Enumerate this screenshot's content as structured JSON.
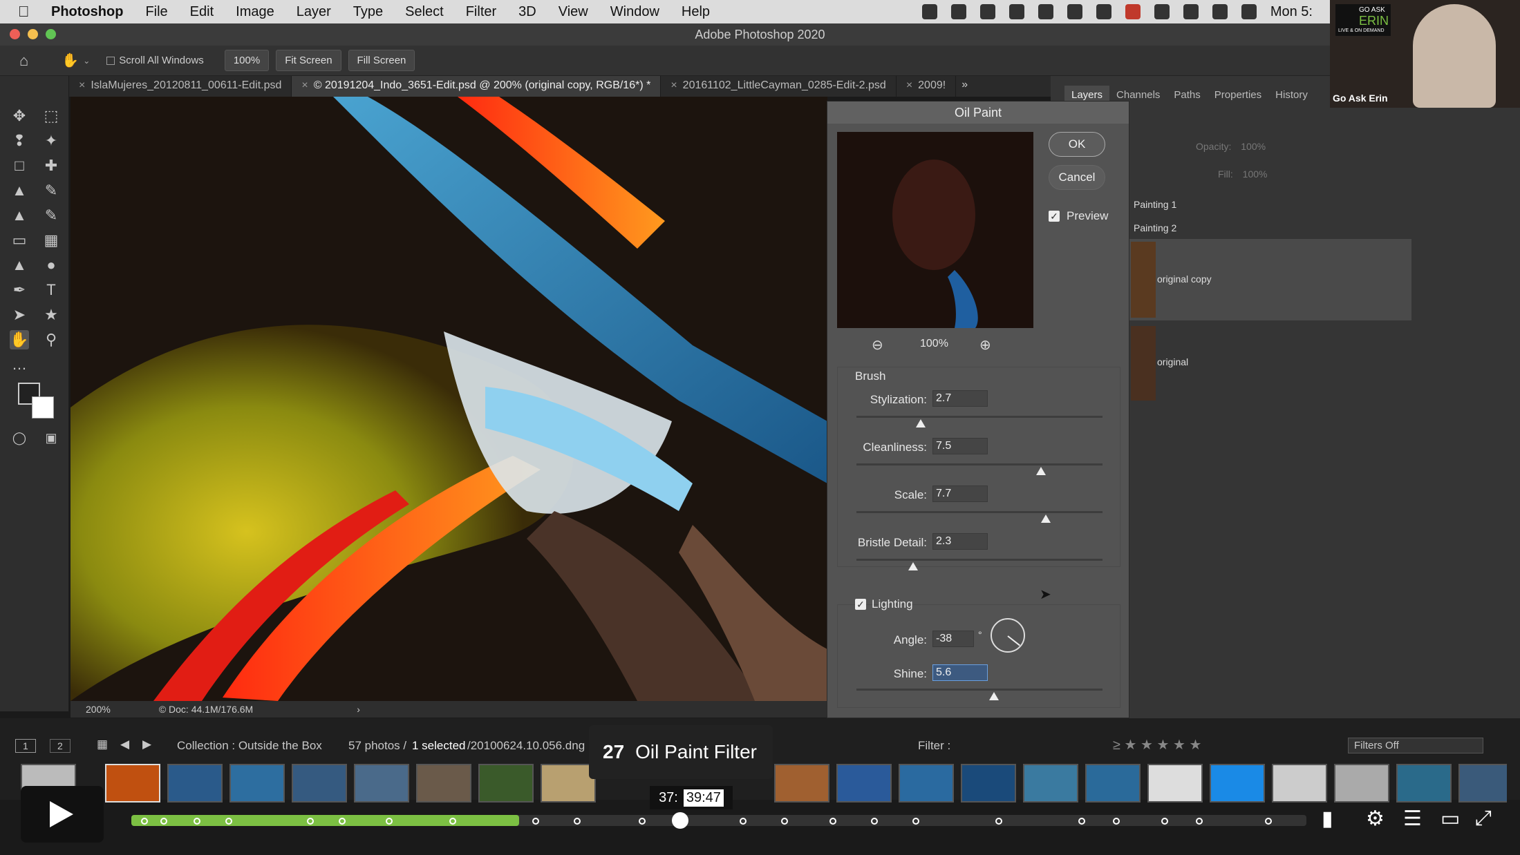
{
  "menubar": {
    "app_name": "Photoshop",
    "items": [
      "File",
      "Edit",
      "Image",
      "Layer",
      "Type",
      "Select",
      "Filter",
      "3D",
      "View",
      "Window",
      "Help"
    ],
    "clock": "Mon 5:"
  },
  "window": {
    "title": "Adobe Photoshop 2020"
  },
  "options_bar": {
    "scroll_all_windows": "Scroll All Windows",
    "zoom_btn": "100%",
    "fit_screen": "Fit Screen",
    "fill_screen": "Fill Screen"
  },
  "doc_tabs": [
    {
      "label": "IslaMujeres_20120811_00611-Edit.psd",
      "active": false
    },
    {
      "label": "© 20191204_Indo_3651-Edit.psd @ 200% (original copy, RGB/16*) *",
      "active": true
    },
    {
      "label": "20161102_LittleCayman_0285-Edit-2.psd",
      "active": false
    },
    {
      "label": "2009!",
      "active": false
    }
  ],
  "status_bar": {
    "zoom": "200%",
    "doc": "© Doc: 44.1M/176.6M"
  },
  "panel_tabs": [
    "Layers",
    "Channels",
    "Paths",
    "Properties",
    "History"
  ],
  "layers_panel": {
    "opacity_label": "Opacity:",
    "opacity_value": "100%",
    "fill_label": "Fill:",
    "fill_value": "100%",
    "layers": [
      "Painting 1",
      "Painting 2",
      "original copy",
      "original"
    ]
  },
  "dialog": {
    "title": "Oil Paint",
    "ok": "OK",
    "cancel": "Cancel",
    "preview": "Preview",
    "zoom": "100%",
    "brush_section": "Brush",
    "stylization_label": "Stylization:",
    "stylization": "2.7",
    "stylization_level": 0.26,
    "cleanliness_label": "Cleanliness:",
    "cleanliness": "7.5",
    "cleanliness_level": 0.75,
    "scale_label": "Scale:",
    "scale": "7.7",
    "scale_level": 0.77,
    "bristle_label": "Bristle Detail:",
    "bristle": "2.3",
    "bristle_level": 0.23,
    "lighting_label": "Lighting",
    "angle_label": "Angle:",
    "angle": "-38",
    "degree": "°",
    "shine_label": "Shine:",
    "shine": "5.6",
    "shine_level": 0.56
  },
  "lightroom": {
    "page1": "1",
    "page2": "2",
    "collection": "Collection : Outside the Box",
    "count": "57 photos /",
    "selected": "1 selected",
    "file": "/20100624.10.056.dng",
    "filter_label": "Filter :",
    "filters_off": "Filters Off"
  },
  "video": {
    "chapter_number": "27",
    "chapter_title": "Oil Paint Filter",
    "time_current": "37:",
    "time_hover": "39:47",
    "progress": 0.33
  },
  "webcam": {
    "brand_top": "GO ASK",
    "brand_name": "ERIN",
    "brand_sub": "LIVE & ON DEMAND",
    "caption": "Go Ask Erin"
  },
  "colors": {
    "accent_green": "#7cc043",
    "dialog_bg": "#535353"
  }
}
